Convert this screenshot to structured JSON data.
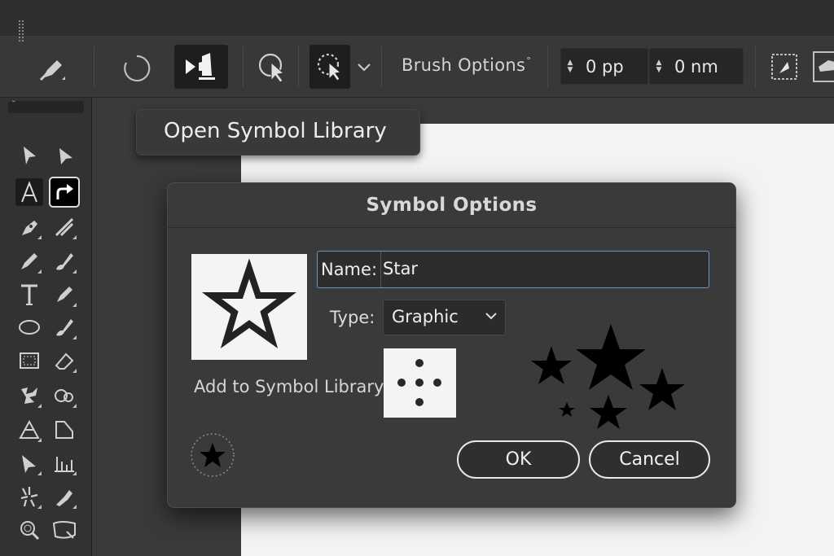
{
  "toolbar": {
    "brush_options_label": "Brush Options",
    "brush_options_mark": "°",
    "spin1_value": "0 pp",
    "spin2_value": "0 nm"
  },
  "tool_panel": {
    "header_glyph": "˘"
  },
  "popup": {
    "label": "Open Symbol Library"
  },
  "dialog": {
    "title": "Symbol Options",
    "name_label": "Name:",
    "name_value": "Star",
    "type_label": "Type:",
    "type_value": "Graphic",
    "add_to_library_label": "Add to Symbol Library",
    "ok_label": "OK",
    "cancel_label": "Cancel"
  },
  "colors": {
    "field_border_focus": "#6a95c9",
    "panel_bg": "#323232",
    "dialog_bg": "#3a3a3a",
    "artboard": "#f3f3f3"
  },
  "icons": [
    "grip-icon",
    "pen-brush-icon",
    "rotate-icon",
    "play-symbol-icon",
    "touch-select-icon",
    "lasso-icon",
    "chevron-down-icon",
    "spin-arrows-icon",
    "transform-icon"
  ]
}
